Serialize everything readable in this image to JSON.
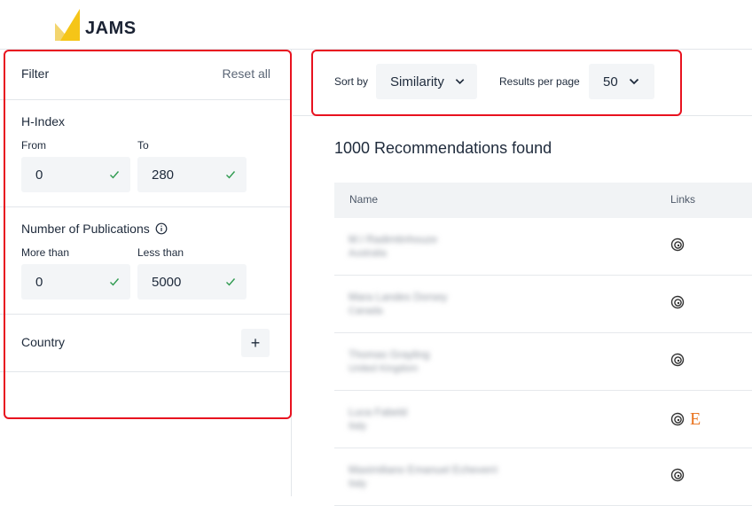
{
  "brand": {
    "name": "JAMS",
    "accent": "#f5c518"
  },
  "filter": {
    "title": "Filter",
    "reset_label": "Reset all",
    "hindex": {
      "title": "H-Index",
      "from_label": "From",
      "to_label": "To",
      "from_value": "0",
      "to_value": "280"
    },
    "publications": {
      "title": "Number of Publications",
      "more_label": "More than",
      "less_label": "Less than",
      "more_value": "0",
      "less_value": "5000"
    },
    "country": {
      "title": "Country",
      "add_symbol": "+"
    }
  },
  "sort": {
    "label": "Sort by",
    "value": "Similarity",
    "per_page_label": "Results per page",
    "per_page_value": "50"
  },
  "results": {
    "count_text": "1000 Recommendations found",
    "columns": {
      "name": "Name",
      "links": "Links"
    },
    "rows": [
      {
        "name": "M.I Radimtinhouze",
        "sub": "Australia",
        "links": [
          "orcid-icon"
        ]
      },
      {
        "name": "Mara Landes Dorsey",
        "sub": "Canada",
        "links": [
          "orcid-icon"
        ]
      },
      {
        "name": "Thomas Grayling",
        "sub": "United Kingdom",
        "links": [
          "orcid-icon"
        ]
      },
      {
        "name": "Luca Fabeld",
        "sub": "Italy",
        "links": [
          "orcid-icon",
          "e-icon"
        ]
      },
      {
        "name": "Maximiliano Emanuel Echeverri",
        "sub": "Italy",
        "links": [
          "orcid-icon"
        ]
      }
    ]
  },
  "colors": {
    "highlight": "#e8121f",
    "checkmark": "#2e9a4f",
    "link_e": "#e9711c"
  }
}
